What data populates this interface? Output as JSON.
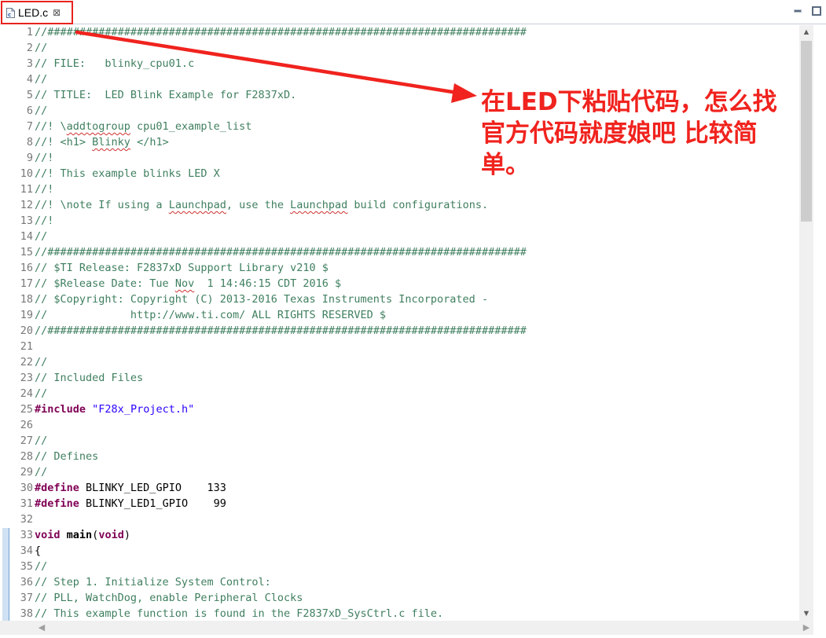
{
  "tab": {
    "label": "LED.c",
    "close": "⊠",
    "icon": "c-file-icon"
  },
  "window_controls": {
    "minimize": "minimize-icon",
    "maximize": "maximize-icon"
  },
  "annotation": {
    "text": "在LED下粘贴代码，怎么找官方代码就度娘吧 比较简单。",
    "color": "#f0231e"
  },
  "colors": {
    "comment": "#3f7f5f",
    "keyword": "#7f0055",
    "string": "#2a00ff",
    "line_number": "#787878",
    "highlight": "#e8231d"
  },
  "lines": [
    {
      "n": "1",
      "parts": [
        {
          "t": "//###########################################################################",
          "c": "cm"
        }
      ]
    },
    {
      "n": "2",
      "parts": [
        {
          "t": "//",
          "c": "cm"
        }
      ]
    },
    {
      "n": "3",
      "parts": [
        {
          "t": "// FILE:   blinky_cpu01.c",
          "c": "cm"
        }
      ]
    },
    {
      "n": "4",
      "parts": [
        {
          "t": "//",
          "c": "cm"
        }
      ]
    },
    {
      "n": "5",
      "parts": [
        {
          "t": "// TITLE:  LED Blink Example for F2837xD.",
          "c": "cm"
        }
      ]
    },
    {
      "n": "6",
      "parts": [
        {
          "t": "//",
          "c": "cm"
        }
      ]
    },
    {
      "n": "7",
      "parts": [
        {
          "t": "//! \\",
          "c": "cm"
        },
        {
          "t": "addtogroup",
          "c": "cm sq"
        },
        {
          "t": " cpu01_example_list",
          "c": "cm"
        }
      ]
    },
    {
      "n": "8",
      "parts": [
        {
          "t": "//! <h1> ",
          "c": "cm"
        },
        {
          "t": "Blinky",
          "c": "cm sq"
        },
        {
          "t": " </h1>",
          "c": "cm"
        }
      ]
    },
    {
      "n": "9",
      "parts": [
        {
          "t": "//!",
          "c": "cm"
        }
      ]
    },
    {
      "n": "10",
      "parts": [
        {
          "t": "//! This example blinks LED X",
          "c": "cm"
        }
      ]
    },
    {
      "n": "11",
      "parts": [
        {
          "t": "//!",
          "c": "cm"
        }
      ]
    },
    {
      "n": "12",
      "parts": [
        {
          "t": "//! \\note If using a ",
          "c": "cm"
        },
        {
          "t": "Launchpad",
          "c": "cm sq"
        },
        {
          "t": ", use the ",
          "c": "cm"
        },
        {
          "t": "Launchpad",
          "c": "cm sq"
        },
        {
          "t": " build configurations.",
          "c": "cm"
        }
      ]
    },
    {
      "n": "13",
      "parts": [
        {
          "t": "//!",
          "c": "cm"
        }
      ]
    },
    {
      "n": "14",
      "parts": [
        {
          "t": "//",
          "c": "cm"
        }
      ]
    },
    {
      "n": "15",
      "parts": [
        {
          "t": "//###########################################################################",
          "c": "cm"
        }
      ]
    },
    {
      "n": "16",
      "parts": [
        {
          "t": "// $TI Release: F2837xD Support Library v210 $",
          "c": "cm"
        }
      ]
    },
    {
      "n": "17",
      "parts": [
        {
          "t": "// $Release Date: Tue ",
          "c": "cm"
        },
        {
          "t": "Nov",
          "c": "cm sq"
        },
        {
          "t": "  1 14:46:15 CDT 2016 $",
          "c": "cm"
        }
      ]
    },
    {
      "n": "18",
      "parts": [
        {
          "t": "// $Copyright: Copyright (C) 2013-2016 Texas Instruments Incorporated -",
          "c": "cm"
        }
      ]
    },
    {
      "n": "19",
      "parts": [
        {
          "t": "//             http://www.ti.com/ ALL RIGHTS RESERVED $",
          "c": "cm"
        }
      ]
    },
    {
      "n": "20",
      "parts": [
        {
          "t": "//###########################################################################",
          "c": "cm"
        }
      ]
    },
    {
      "n": "21",
      "parts": []
    },
    {
      "n": "22",
      "parts": [
        {
          "t": "//",
          "c": "cm"
        }
      ]
    },
    {
      "n": "23",
      "parts": [
        {
          "t": "// Included Files",
          "c": "cm"
        }
      ]
    },
    {
      "n": "24",
      "parts": [
        {
          "t": "//",
          "c": "cm"
        }
      ]
    },
    {
      "n": "25",
      "parts": [
        {
          "t": "#include",
          "c": "kw"
        },
        {
          "t": " ",
          "c": "plain"
        },
        {
          "t": "\"F28x_Project.h\"",
          "c": "str"
        }
      ]
    },
    {
      "n": "26",
      "parts": []
    },
    {
      "n": "27",
      "parts": [
        {
          "t": "//",
          "c": "cm"
        }
      ]
    },
    {
      "n": "28",
      "parts": [
        {
          "t": "// Defines",
          "c": "cm"
        }
      ]
    },
    {
      "n": "29",
      "parts": [
        {
          "t": "//",
          "c": "cm"
        }
      ]
    },
    {
      "n": "30",
      "parts": [
        {
          "t": "#define",
          "c": "kw"
        },
        {
          "t": " BLINKY_LED_GPIO    133",
          "c": "plain"
        }
      ]
    },
    {
      "n": "31",
      "parts": [
        {
          "t": "#define",
          "c": "kw"
        },
        {
          "t": " BLINKY_LED1_GPIO    99",
          "c": "plain"
        }
      ]
    },
    {
      "n": "32",
      "parts": []
    },
    {
      "n": "33",
      "parts": [
        {
          "t": "void",
          "c": "kw"
        },
        {
          "t": " ",
          "c": "plain"
        },
        {
          "t": "main",
          "c": "plain b"
        },
        {
          "t": "(",
          "c": "plain"
        },
        {
          "t": "void",
          "c": "kw"
        },
        {
          "t": ")",
          "c": "plain"
        }
      ]
    },
    {
      "n": "34",
      "parts": [
        {
          "t": "{",
          "c": "plain"
        }
      ]
    },
    {
      "n": "35",
      "parts": [
        {
          "t": "//",
          "c": "cm"
        }
      ]
    },
    {
      "n": "36",
      "parts": [
        {
          "t": "// Step 1. Initialize System Control:",
          "c": "cm"
        }
      ]
    },
    {
      "n": "37",
      "parts": [
        {
          "t": "// PLL, WatchDog, enable Peripheral Clocks",
          "c": "cm"
        }
      ]
    },
    {
      "n": "38",
      "parts": [
        {
          "t": "// This example function is found in the F2837xD_SysCtrl.c file.",
          "c": "cm"
        }
      ]
    }
  ]
}
